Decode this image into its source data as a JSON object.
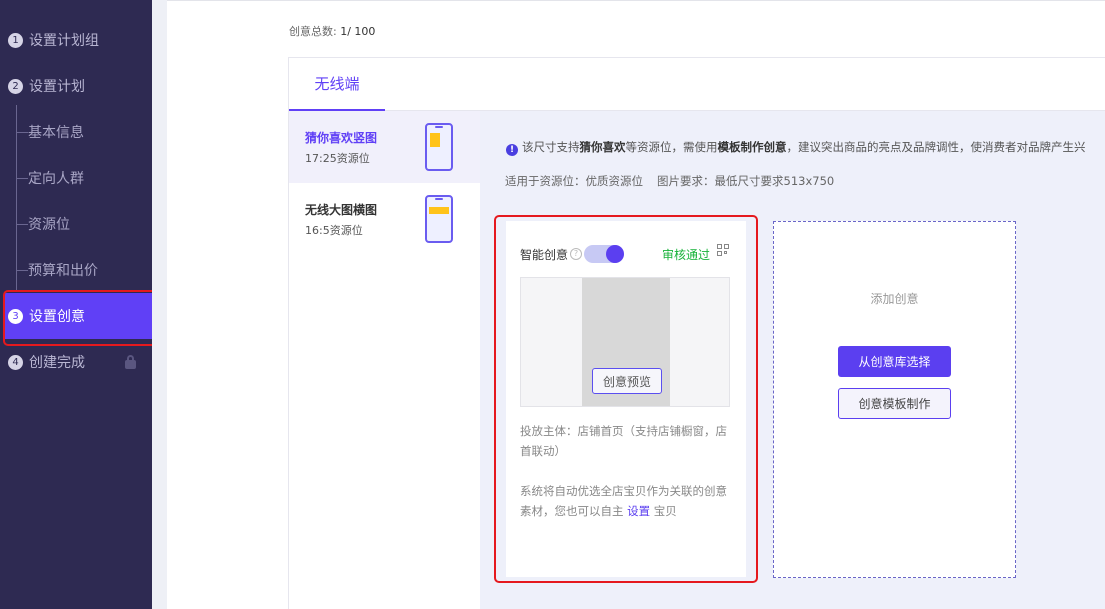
{
  "sidebar": {
    "steps": [
      {
        "num": "1",
        "label": "设置计划组"
      },
      {
        "num": "2",
        "label": "设置计划"
      },
      {
        "num": "3",
        "label": "设置创意"
      },
      {
        "num": "4",
        "label": "创建完成"
      }
    ],
    "substeps": [
      "基本信息",
      "定向人群",
      "资源位",
      "预算和出价"
    ]
  },
  "main": {
    "count_label": "创意总数:",
    "count_value": "1/ 100",
    "tab": "无线端",
    "sizes": [
      {
        "name": "猜你喜欢竖图",
        "sub": "17:25资源位"
      },
      {
        "name": "无线大图横图",
        "sub": "16:5资源位"
      }
    ],
    "notice": {
      "p1": "该尺寸支持",
      "b1": "猜你喜欢",
      "p2": "等资源位，需使用",
      "b2": "模板制作创意",
      "p3": "，建议突出商品的亮点及品牌调性，使消费者对品牌产生兴"
    },
    "req_place": "适用于资源位：优质资源位",
    "req_image": "图片要求：最低尺寸要求513x750",
    "card": {
      "smart_label": "智能创意",
      "status": "审核通过",
      "preview_button": "创意预览",
      "desc1": "投放主体：店铺首页（支持店铺橱窗，店首联动）",
      "desc2_pre": "系统将自动优选全店宝贝作为关联的创意素材，您也可以自主 ",
      "desc2_link": "设置",
      "desc2_post": " 宝贝"
    },
    "add": {
      "title": "添加创意",
      "from_library": "从创意库选择",
      "template": "创意模板制作"
    }
  },
  "colors": {
    "accent": "#6040f6",
    "sidebar_bg": "#2e2a52",
    "pass": "#18b33a",
    "highlight": "#e5191e"
  }
}
